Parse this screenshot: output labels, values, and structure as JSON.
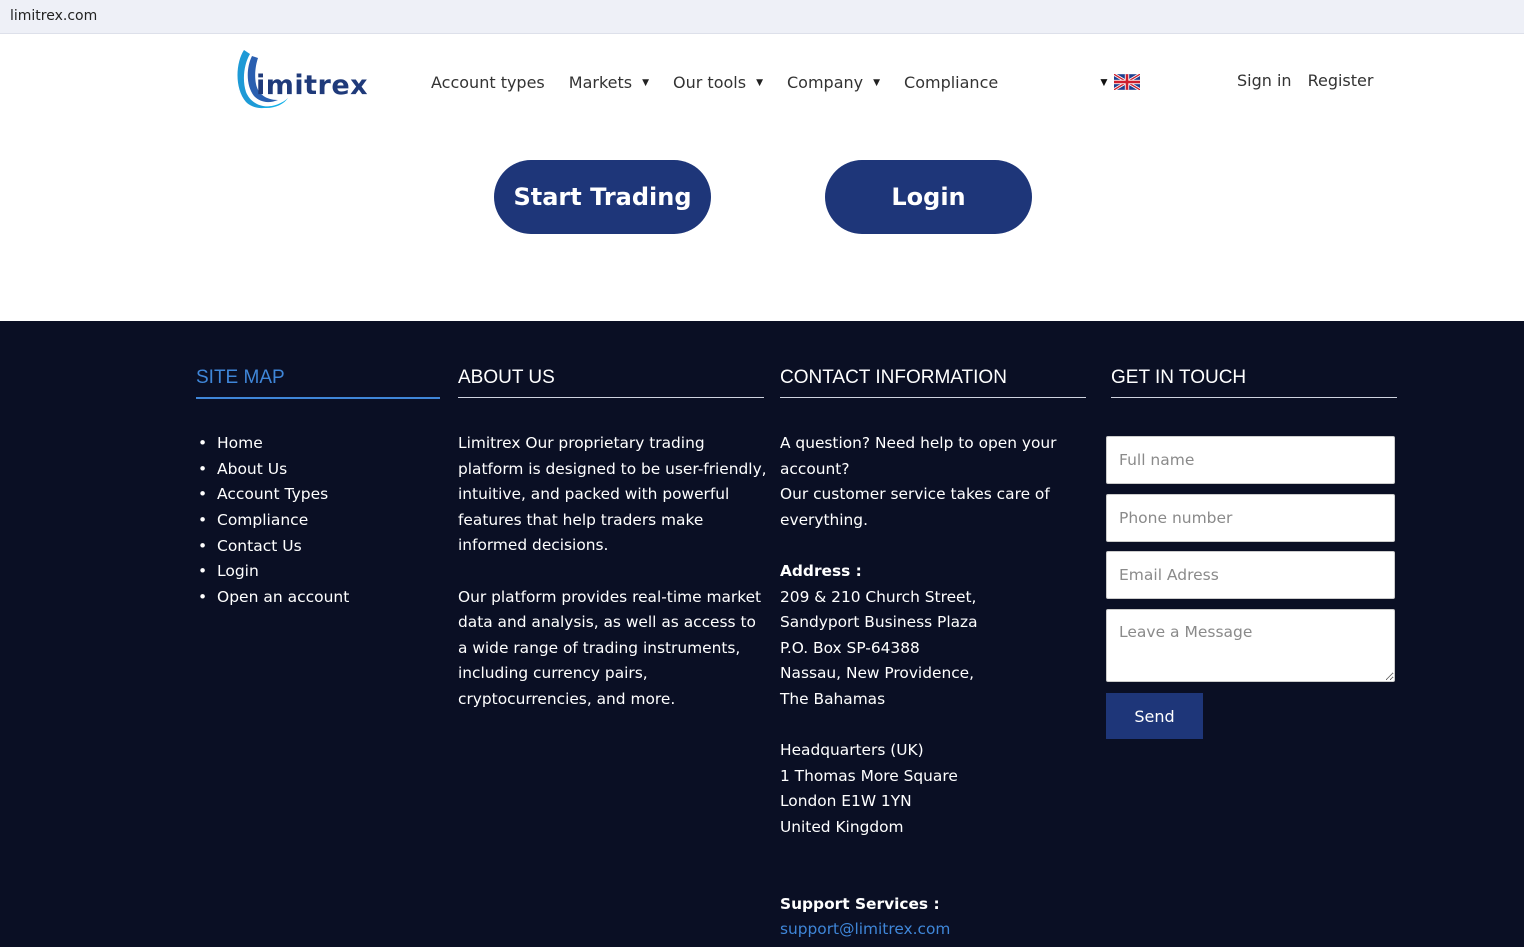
{
  "browser": {
    "url": "limitrex.com"
  },
  "header": {
    "logo_text": "imitrex",
    "nav": [
      {
        "label": "Account types",
        "has_caret": false
      },
      {
        "label": "Markets",
        "has_caret": true
      },
      {
        "label": "Our tools",
        "has_caret": true
      },
      {
        "label": "Company",
        "has_caret": true
      },
      {
        "label": "Compliance",
        "has_caret": false
      }
    ],
    "sign_in": "Sign in",
    "register": "Register"
  },
  "hero": {
    "start_trading": "Start Trading",
    "login": "Login"
  },
  "footer": {
    "sitemap": {
      "title": "SITE MAP",
      "items": [
        "Home",
        "About Us",
        "Account Types",
        "Compliance",
        "Contact Us",
        "Login",
        "Open an account"
      ]
    },
    "about": {
      "title": "ABOUT US",
      "p1": "Limitrex Our proprietary trading platform is designed to be user-friendly, intuitive, and packed with powerful features that help traders make informed decisions.",
      "p2": "Our platform provides real-time market data and analysis, as well as access to a wide range of trading instruments, including currency pairs, cryptocurrencies, and more."
    },
    "contact": {
      "title": "CONTACT INFORMATION",
      "intro1": "A question? Need help to open your",
      "intro2": "account?",
      "intro3": "Our customer service takes care of",
      "intro4": "everything.",
      "address_label": "Address :",
      "address": [
        "209 & 210 Church Street,",
        "Sandyport Business Plaza",
        "P.O. Box SP-64388",
        "Nassau, New Providence,",
        "The Bahamas"
      ],
      "hq": [
        "Headquarters (UK)",
        "1 Thomas More Square",
        "London E1W 1YN",
        "United Kingdom"
      ],
      "support_label": "Support Services :",
      "support_email": "support@limitrex.com"
    },
    "touch": {
      "title": "GET IN TOUCH",
      "full_name_placeholder": "Full name",
      "phone_placeholder": "Phone number",
      "email_placeholder": "Email Adress",
      "message_placeholder": "Leave a Message",
      "send_label": "Send"
    }
  },
  "colors": {
    "primary": "#1e3679",
    "footer_bg": "#0a0f24",
    "accent_blue": "#3f86d8"
  }
}
